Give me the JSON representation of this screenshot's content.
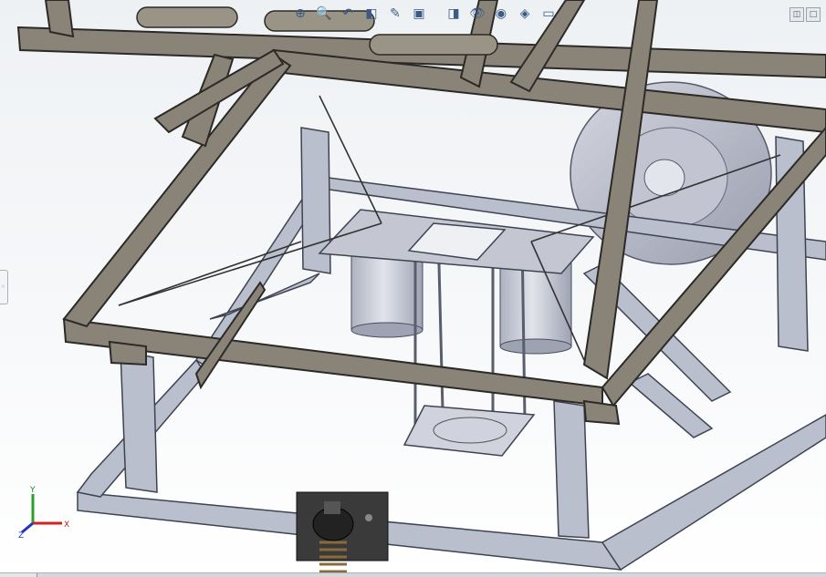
{
  "view": {
    "background_top": "#eef1f4",
    "background_bottom": "#ffffff",
    "frame_color": "#8a8478",
    "frame_edge": "#2b2a27",
    "inner_frame_color": "#b9bfcc",
    "tank_color": "#c9ccd8"
  },
  "hud_toolbar": {
    "buttons": [
      {
        "icon": "zoom-to-fit-icon",
        "glyph": "⊕"
      },
      {
        "icon": "zoom-area-icon",
        "glyph": "🔍"
      },
      {
        "icon": "previous-view-icon",
        "glyph": "↶"
      },
      {
        "icon": "section-view-icon",
        "glyph": "◧"
      },
      {
        "icon": "dynamic-annotation-icon",
        "glyph": "✎"
      },
      {
        "icon": "view-orientation-icon",
        "glyph": "▣"
      },
      {
        "icon": "display-style-icon",
        "glyph": "◨"
      },
      {
        "icon": "hide-show-items-icon",
        "glyph": "👁"
      },
      {
        "icon": "edit-appearance-icon",
        "glyph": "◉"
      },
      {
        "icon": "apply-scene-icon",
        "glyph": "◈"
      },
      {
        "icon": "view-settings-icon",
        "glyph": "▭"
      }
    ]
  },
  "window_controls": [
    {
      "icon": "restore-icon",
      "glyph": "◫"
    },
    {
      "icon": "maximize-icon",
      "glyph": "□"
    }
  ],
  "triad": {
    "y_label": "Y",
    "x_label": "X",
    "z_label": "Z",
    "x_color": "#d62020",
    "y_color": "#2aa02a",
    "z_color": "#2030c8"
  },
  "side_handle": {
    "glyph": "◦"
  }
}
